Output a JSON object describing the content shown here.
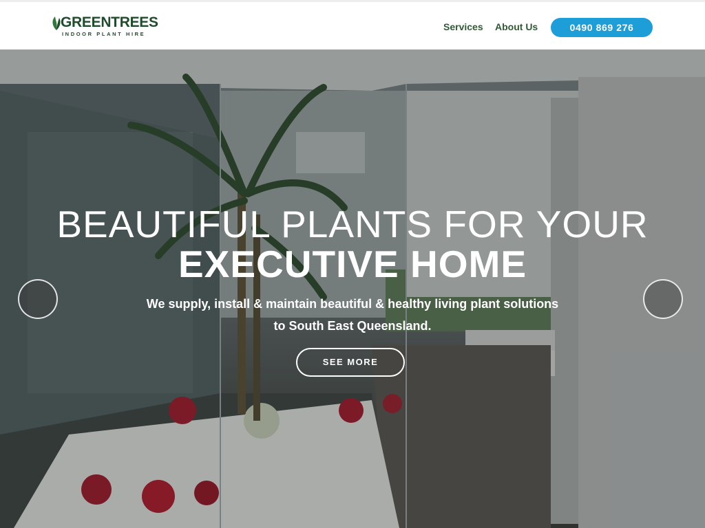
{
  "brand": {
    "name": "GREENTREES",
    "tagline": "INDOOR PLANT HIRE",
    "leaf_icon": "leaf-icon",
    "color": "#1f4d2c"
  },
  "nav": {
    "services": "Services",
    "about": "About Us",
    "phone": "0490 869 276",
    "phone_color": "#1e9ed8"
  },
  "hero": {
    "headline_line1": "BEAUTIFUL PLANTS FOR YOUR",
    "headline_line2": "EXECUTIVE HOME",
    "subtext_line1": "We supply, install & maintain beautiful & healthy living plant solutions",
    "subtext_line2": "to South East Queensland.",
    "cta": "SEE MORE",
    "prev_icon": "circle-prev-icon",
    "next_icon": "circle-next-icon"
  }
}
